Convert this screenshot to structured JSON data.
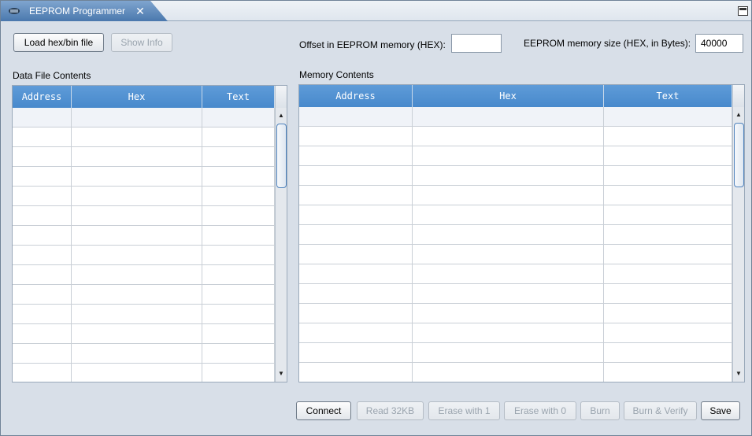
{
  "window": {
    "tab_title": "EEPROM Programmer",
    "tab_icon": "chip-icon",
    "close_icon": "close-icon",
    "maximize_icon": "maximize-icon"
  },
  "toolbar": {
    "load_label": "Load hex/bin file",
    "show_info_label": "Show Info",
    "offset_label": "Offset in EEPROM memory (HEX):",
    "offset_value": "",
    "size_label": "EEPROM memory size (HEX, in Bytes):",
    "size_value": "40000"
  },
  "data_file": {
    "title": "Data File Contents",
    "columns": [
      "Address",
      "Hex",
      "Text"
    ]
  },
  "memory": {
    "title": "Memory Contents",
    "columns": [
      "Address",
      "Hex",
      "Text"
    ]
  },
  "actions": {
    "connect": "Connect",
    "read": "Read 32KB",
    "erase1": "Erase with 1",
    "erase0": "Erase with 0",
    "burn": "Burn",
    "burn_verify": "Burn & Verify",
    "save": "Save"
  },
  "colors": {
    "header_blue": "#4889cc",
    "tab_blue": "#4a78ad"
  }
}
